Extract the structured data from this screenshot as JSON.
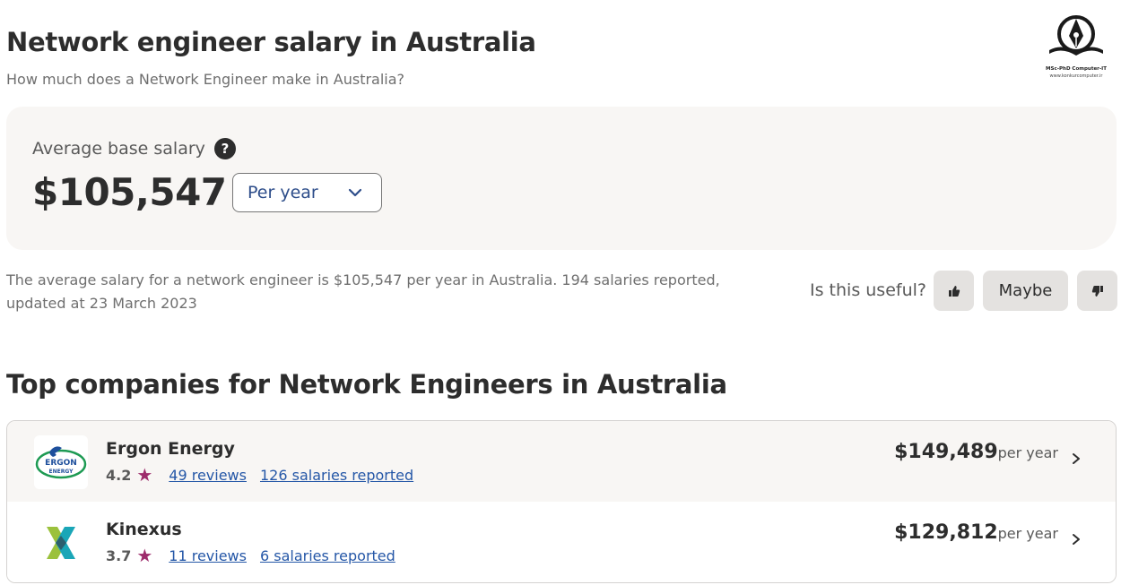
{
  "header": {
    "title": "Network engineer salary in Australia",
    "subtitle": "How much does a Network Engineer make in Australia?"
  },
  "logo": {
    "name": "MSc-PhD Computer-IT",
    "url": "www.konkurcomputer.ir",
    "icon": "pen-nib-book-icon"
  },
  "salary_card": {
    "label": "Average base salary",
    "help_icon": "?",
    "amount": "$105,547",
    "period": "Per year"
  },
  "summary": {
    "text": "The average salary for a network engineer is $105,547 per year in Australia.  194 salaries reported, updated at 23 March 2023"
  },
  "feedback": {
    "question": "Is this useful?",
    "maybe_label": "Maybe",
    "up_icon": "thumbs-up-icon",
    "down_icon": "thumbs-down-icon"
  },
  "companies_section": {
    "title": "Top companies for Network Engineers in Australia",
    "items": [
      {
        "name": "Ergon Energy",
        "logo_text_1": "ERGON",
        "logo_text_2": "ENERGY",
        "rating": "4.2",
        "reviews": "49 reviews",
        "salaries": "126 salaries reported",
        "salary": "$149,489",
        "period": "per year"
      },
      {
        "name": "Kinexus",
        "rating": "3.7",
        "reviews": "11 reviews",
        "salaries": "6 salaries reported",
        "salary": "$129,812",
        "period": "per year"
      }
    ]
  },
  "colors": {
    "accent_link": "#2557a7",
    "star": "#9d2b6b",
    "card_bg": "#f8f6f4"
  }
}
